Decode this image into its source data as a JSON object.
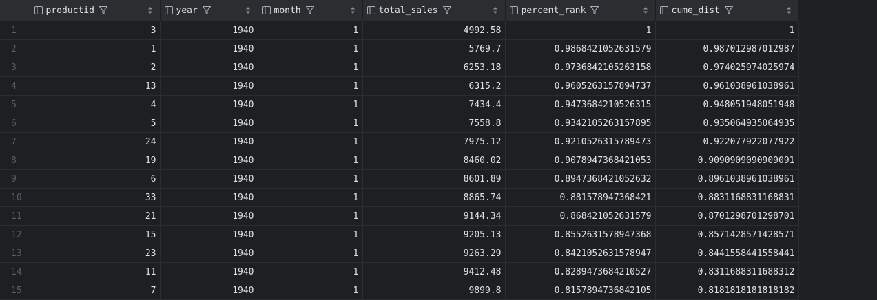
{
  "columns": [
    {
      "name": "productid"
    },
    {
      "name": "year"
    },
    {
      "name": "month"
    },
    {
      "name": "total_sales"
    },
    {
      "name": "percent_rank"
    },
    {
      "name": "cume_dist"
    }
  ],
  "icons": {
    "column": "column-icon",
    "filter": "filter-icon",
    "sort": "sort-icon"
  },
  "colors": {
    "background": "#1e1f22",
    "header_background": "#2b2d30",
    "text": "#dfe1e5",
    "row_number": "#5b5e66"
  },
  "rows": [
    {
      "num": "1",
      "productid": "3",
      "year": "1940",
      "month": "1",
      "total_sales": "4992.58",
      "percent_rank": "1",
      "cume_dist": "1"
    },
    {
      "num": "2",
      "productid": "1",
      "year": "1940",
      "month": "1",
      "total_sales": "5769.7",
      "percent_rank": "0.9868421052631579",
      "cume_dist": "0.987012987012987"
    },
    {
      "num": "3",
      "productid": "2",
      "year": "1940",
      "month": "1",
      "total_sales": "6253.18",
      "percent_rank": "0.9736842105263158",
      "cume_dist": "0.974025974025974"
    },
    {
      "num": "4",
      "productid": "13",
      "year": "1940",
      "month": "1",
      "total_sales": "6315.2",
      "percent_rank": "0.9605263157894737",
      "cume_dist": "0.961038961038961"
    },
    {
      "num": "5",
      "productid": "4",
      "year": "1940",
      "month": "1",
      "total_sales": "7434.4",
      "percent_rank": "0.9473684210526315",
      "cume_dist": "0.948051948051948"
    },
    {
      "num": "6",
      "productid": "5",
      "year": "1940",
      "month": "1",
      "total_sales": "7558.8",
      "percent_rank": "0.9342105263157895",
      "cume_dist": "0.935064935064935"
    },
    {
      "num": "7",
      "productid": "24",
      "year": "1940",
      "month": "1",
      "total_sales": "7975.12",
      "percent_rank": "0.9210526315789473",
      "cume_dist": "0.922077922077922"
    },
    {
      "num": "8",
      "productid": "19",
      "year": "1940",
      "month": "1",
      "total_sales": "8460.02",
      "percent_rank": "0.9078947368421053",
      "cume_dist": "0.9090909090909091"
    },
    {
      "num": "9",
      "productid": "6",
      "year": "1940",
      "month": "1",
      "total_sales": "8601.89",
      "percent_rank": "0.8947368421052632",
      "cume_dist": "0.8961038961038961"
    },
    {
      "num": "10",
      "productid": "33",
      "year": "1940",
      "month": "1",
      "total_sales": "8865.74",
      "percent_rank": "0.881578947368421",
      "cume_dist": "0.8831168831168831"
    },
    {
      "num": "11",
      "productid": "21",
      "year": "1940",
      "month": "1",
      "total_sales": "9144.34",
      "percent_rank": "0.868421052631579",
      "cume_dist": "0.8701298701298701"
    },
    {
      "num": "12",
      "productid": "15",
      "year": "1940",
      "month": "1",
      "total_sales": "9205.13",
      "percent_rank": "0.8552631578947368",
      "cume_dist": "0.8571428571428571"
    },
    {
      "num": "13",
      "productid": "23",
      "year": "1940",
      "month": "1",
      "total_sales": "9263.29",
      "percent_rank": "0.8421052631578947",
      "cume_dist": "0.8441558441558441"
    },
    {
      "num": "14",
      "productid": "11",
      "year": "1940",
      "month": "1",
      "total_sales": "9412.48",
      "percent_rank": "0.8289473684210527",
      "cume_dist": "0.8311688311688312"
    },
    {
      "num": "15",
      "productid": "7",
      "year": "1940",
      "month": "1",
      "total_sales": "9899.8",
      "percent_rank": "0.8157894736842105",
      "cume_dist": "0.8181818181818182"
    }
  ]
}
